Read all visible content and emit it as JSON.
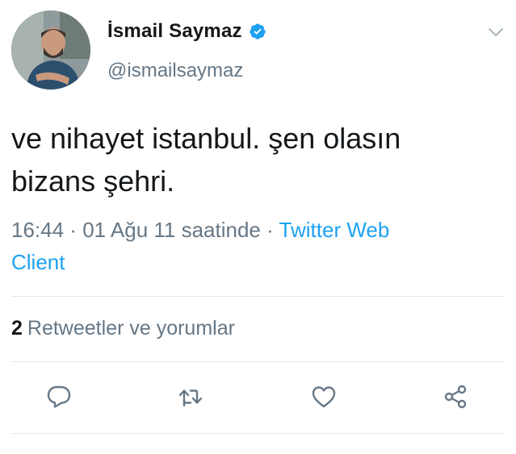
{
  "tweet": {
    "display_name": "İsmail Saymaz",
    "handle": "@ismailsaymaz",
    "verified": true,
    "text_line1": "ve nihayet istanbul. şen olasın",
    "text_line2": "bizans şehri.",
    "time": "16:44",
    "separator1": " · ",
    "date": "01 Ağu 11 saatinde",
    "separator2": " · ",
    "source_line1": "Twitter Web",
    "source_line2": "Client"
  },
  "engagement": {
    "count": "2",
    "label": "Retweetler ve yorumlar"
  },
  "icons": {
    "verified": "verified-badge-icon",
    "menu": "chevron-down-icon",
    "reply": "reply-icon",
    "retweet": "retweet-icon",
    "like": "heart-icon",
    "share": "share-icon"
  },
  "colors": {
    "text": "#14171a",
    "secondary": "#657786",
    "link": "#1da1f2",
    "verified": "#1da1f2",
    "divider": "#e1e8ed"
  }
}
